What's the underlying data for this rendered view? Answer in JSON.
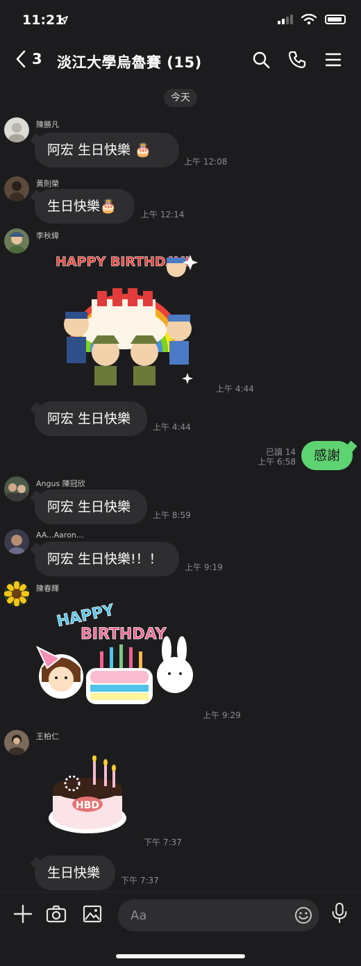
{
  "status_bar": {
    "time": "11:21"
  },
  "header": {
    "unread_count": "3",
    "title": "淡江大學烏魯賽 (15)"
  },
  "date_divider": "今天",
  "messages": [
    {
      "sender": "陳勝凡",
      "text": "阿宏  生日快樂 🎂",
      "time": "上午 12:08"
    },
    {
      "sender": "黃則榮",
      "text": "生日快樂🎂",
      "time": "上午 12:14"
    },
    {
      "sender": "李秋緯",
      "sticker": "happy-birthday-rainbow-scouts-sticker",
      "sticker_text": "HAPPY BIRTHDAY!",
      "time": "上午 4:44"
    },
    {
      "sender": "",
      "text": "阿宏 生日快樂",
      "time": "上午 4:44"
    },
    {
      "sender": "Angus 陳冠欣",
      "text": "阿宏 生日快樂",
      "time": "上午 8:59"
    },
    {
      "sender": "AA...Aaron...",
      "text": "阿宏 生日快樂!！！",
      "time": "上午 9:19"
    },
    {
      "sender": "陳春輝",
      "sticker": "happy-birthday-cake-girl-bunny-sticker",
      "sticker_text_1": "HAPPY",
      "sticker_text_2": "BIRTHDAY",
      "time": "上午 9:29"
    },
    {
      "sender": "王柏仁",
      "sticker": "hbd-cake-sticker",
      "sticker_text": "HBD",
      "time": "下午 7:37"
    },
    {
      "sender": "",
      "text": "生日快樂",
      "time": "下午 7:37"
    }
  ],
  "outgoing": {
    "text": "感謝",
    "read": "已讀 14",
    "time": "上午 6:58"
  },
  "input": {
    "placeholder": "Aa"
  },
  "colors": {
    "background": "#1c1c1e",
    "bubble_in": "#2e2e31",
    "bubble_out": "#5ed371"
  }
}
